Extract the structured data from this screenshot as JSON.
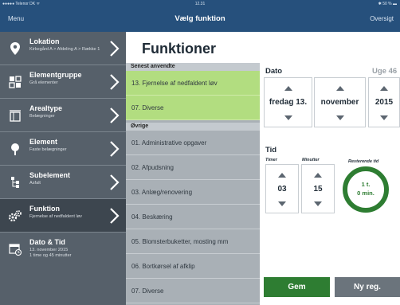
{
  "status_bar": {
    "carrier": "●●●●● Telenor DK ᯤ",
    "time": "12.31",
    "battery": "✱ 50 % ▬"
  },
  "nav": {
    "left": "Menu",
    "title": "Vælg funktion",
    "right": "Oversigt"
  },
  "sidebar": {
    "items": [
      {
        "icon": "location-pin-icon",
        "title": "Lokation",
        "subtitle": "Kirkegård A > Afdeling A > Række 1",
        "active": false
      },
      {
        "icon": "element-group-icon",
        "title": "Elementgruppe",
        "subtitle": "Grå elementer",
        "active": false
      },
      {
        "icon": "area-type-icon",
        "title": "Arealtype",
        "subtitle": "Belægninger",
        "active": false
      },
      {
        "icon": "tree-icon",
        "title": "Element",
        "subtitle": "Faste belægninger",
        "active": false
      },
      {
        "icon": "subelement-icon",
        "title": "Subelement",
        "subtitle": "Asfalt",
        "active": false
      },
      {
        "icon": "gears-icon",
        "title": "Funktion",
        "subtitle": "Fjernelse af nedfaldent løv",
        "active": true
      },
      {
        "icon": "calendar-clock-icon",
        "title": "Dato & Tid",
        "subtitle": "13. november 2015\n1 time og 45 minutter",
        "active": false
      }
    ]
  },
  "main": {
    "title": "Funktioner",
    "recent_header": "Senest anvendte",
    "recent": [
      "13. Fjernelse af nedfaldent løv",
      "07. Diverse"
    ],
    "other_header": "Øvrige",
    "other": [
      "01. Administrative opgaver",
      "02. Afpudsning",
      "03. Anlæg/renovering",
      "04. Beskæring",
      "05. Blomsterbuketter, mosting mm",
      "06. Bortkørsel af afklip",
      "07. Diverse"
    ]
  },
  "date": {
    "label": "Dato",
    "week": "Uge 46",
    "day": "fredag 13.",
    "month": "november",
    "year": "2015"
  },
  "time": {
    "label": "Tid",
    "hours_label": "Timer",
    "minutes_label": "Minutter",
    "hours": "03",
    "minutes": "15",
    "remaining_label": "Resterende tid",
    "remaining_line1": "1 t.",
    "remaining_line2": "0 min."
  },
  "buttons": {
    "save": "Gem",
    "new_reg": "Ny reg."
  },
  "colors": {
    "nav": "#26507c",
    "sidebar": "#56606a",
    "recent": "#b2dd80",
    "accent_green": "#2e7d32"
  }
}
